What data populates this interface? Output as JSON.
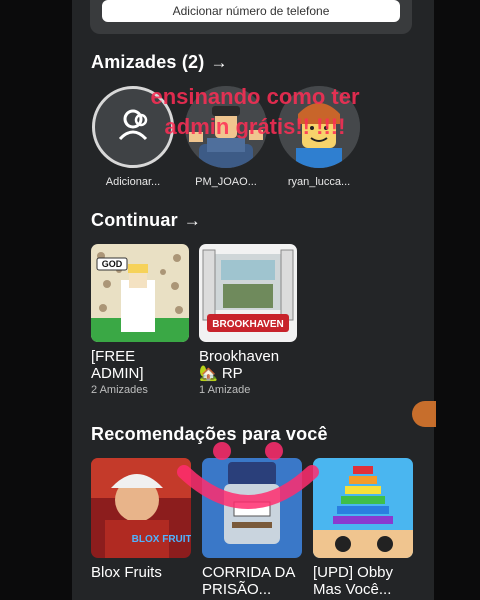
{
  "telefone_button": "Adicionar número de telefone",
  "amizades": {
    "title": "Amizades (2)",
    "friends": [
      {
        "name": "Adicionar..."
      },
      {
        "name": "PM_JOAO..."
      },
      {
        "name": "ryan_lucca..."
      }
    ]
  },
  "overlay_text": "ensinando como ter admin grátis!! !!!!",
  "continuar": {
    "title": "Continuar",
    "games": [
      {
        "title": "[FREE ADMIN]",
        "sub": "2 Amizades",
        "thumb_label": "GOD"
      },
      {
        "title": "Brookhaven 🏡 RP",
        "sub": "1 Amizade",
        "thumb_label": "BROOKHAVEN"
      }
    ]
  },
  "recomendacoes": {
    "title": "Recomendações para você",
    "games": [
      {
        "title": "Blox Fruits",
        "thumb_label": "BLOX FRUITS"
      },
      {
        "title": "CORRIDA DA PRISÃO..."
      },
      {
        "title": "[UPD] Obby Mas Você..."
      }
    ]
  },
  "colors": {
    "background": "#232527",
    "overlay": "#ff2d55",
    "accent_orange": "#d9772d"
  }
}
